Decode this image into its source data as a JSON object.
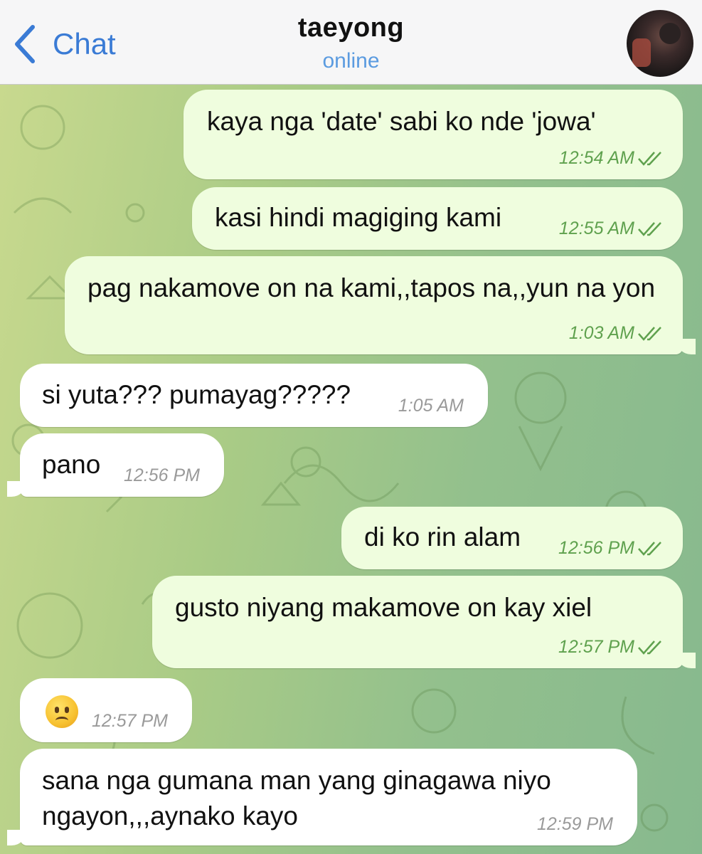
{
  "header": {
    "back_label": "Chat",
    "contact_name": "taeyong",
    "contact_status": "online"
  },
  "messages": [
    {
      "direction": "outgoing",
      "text": "kaya nga 'date' sabi ko nde 'jowa'",
      "time": "12:54 AM",
      "read": true
    },
    {
      "direction": "outgoing",
      "text": "kasi hindi magiging kami",
      "time": "12:55 AM",
      "read": true
    },
    {
      "direction": "outgoing",
      "text": "pag nakamove on na kami,,tapos na,,yun na yon",
      "time": "1:03 AM",
      "read": true
    },
    {
      "direction": "incoming",
      "text": "si yuta??? pumayag?????",
      "time": "1:05 AM"
    },
    {
      "direction": "incoming",
      "text": "pano",
      "time": "12:56 PM"
    },
    {
      "direction": "outgoing",
      "text": "di ko rin alam",
      "time": "12:56 PM",
      "read": true
    },
    {
      "direction": "outgoing",
      "text": "gusto niyang makamove on kay xiel",
      "time": "12:57 PM",
      "read": true
    },
    {
      "direction": "incoming",
      "emoji": "worried-face-emoji",
      "time": "12:57 PM"
    },
    {
      "direction": "incoming",
      "text": "sana nga gumana man yang ginagawa niyo ngayon,,,aynako kayo",
      "time": "12:59 PM"
    }
  ],
  "colors": {
    "outgoing_bubble": "#effdde",
    "incoming_bubble": "#ffffff",
    "outgoing_time": "#5fa14e",
    "accent": "#3a7bd5"
  }
}
